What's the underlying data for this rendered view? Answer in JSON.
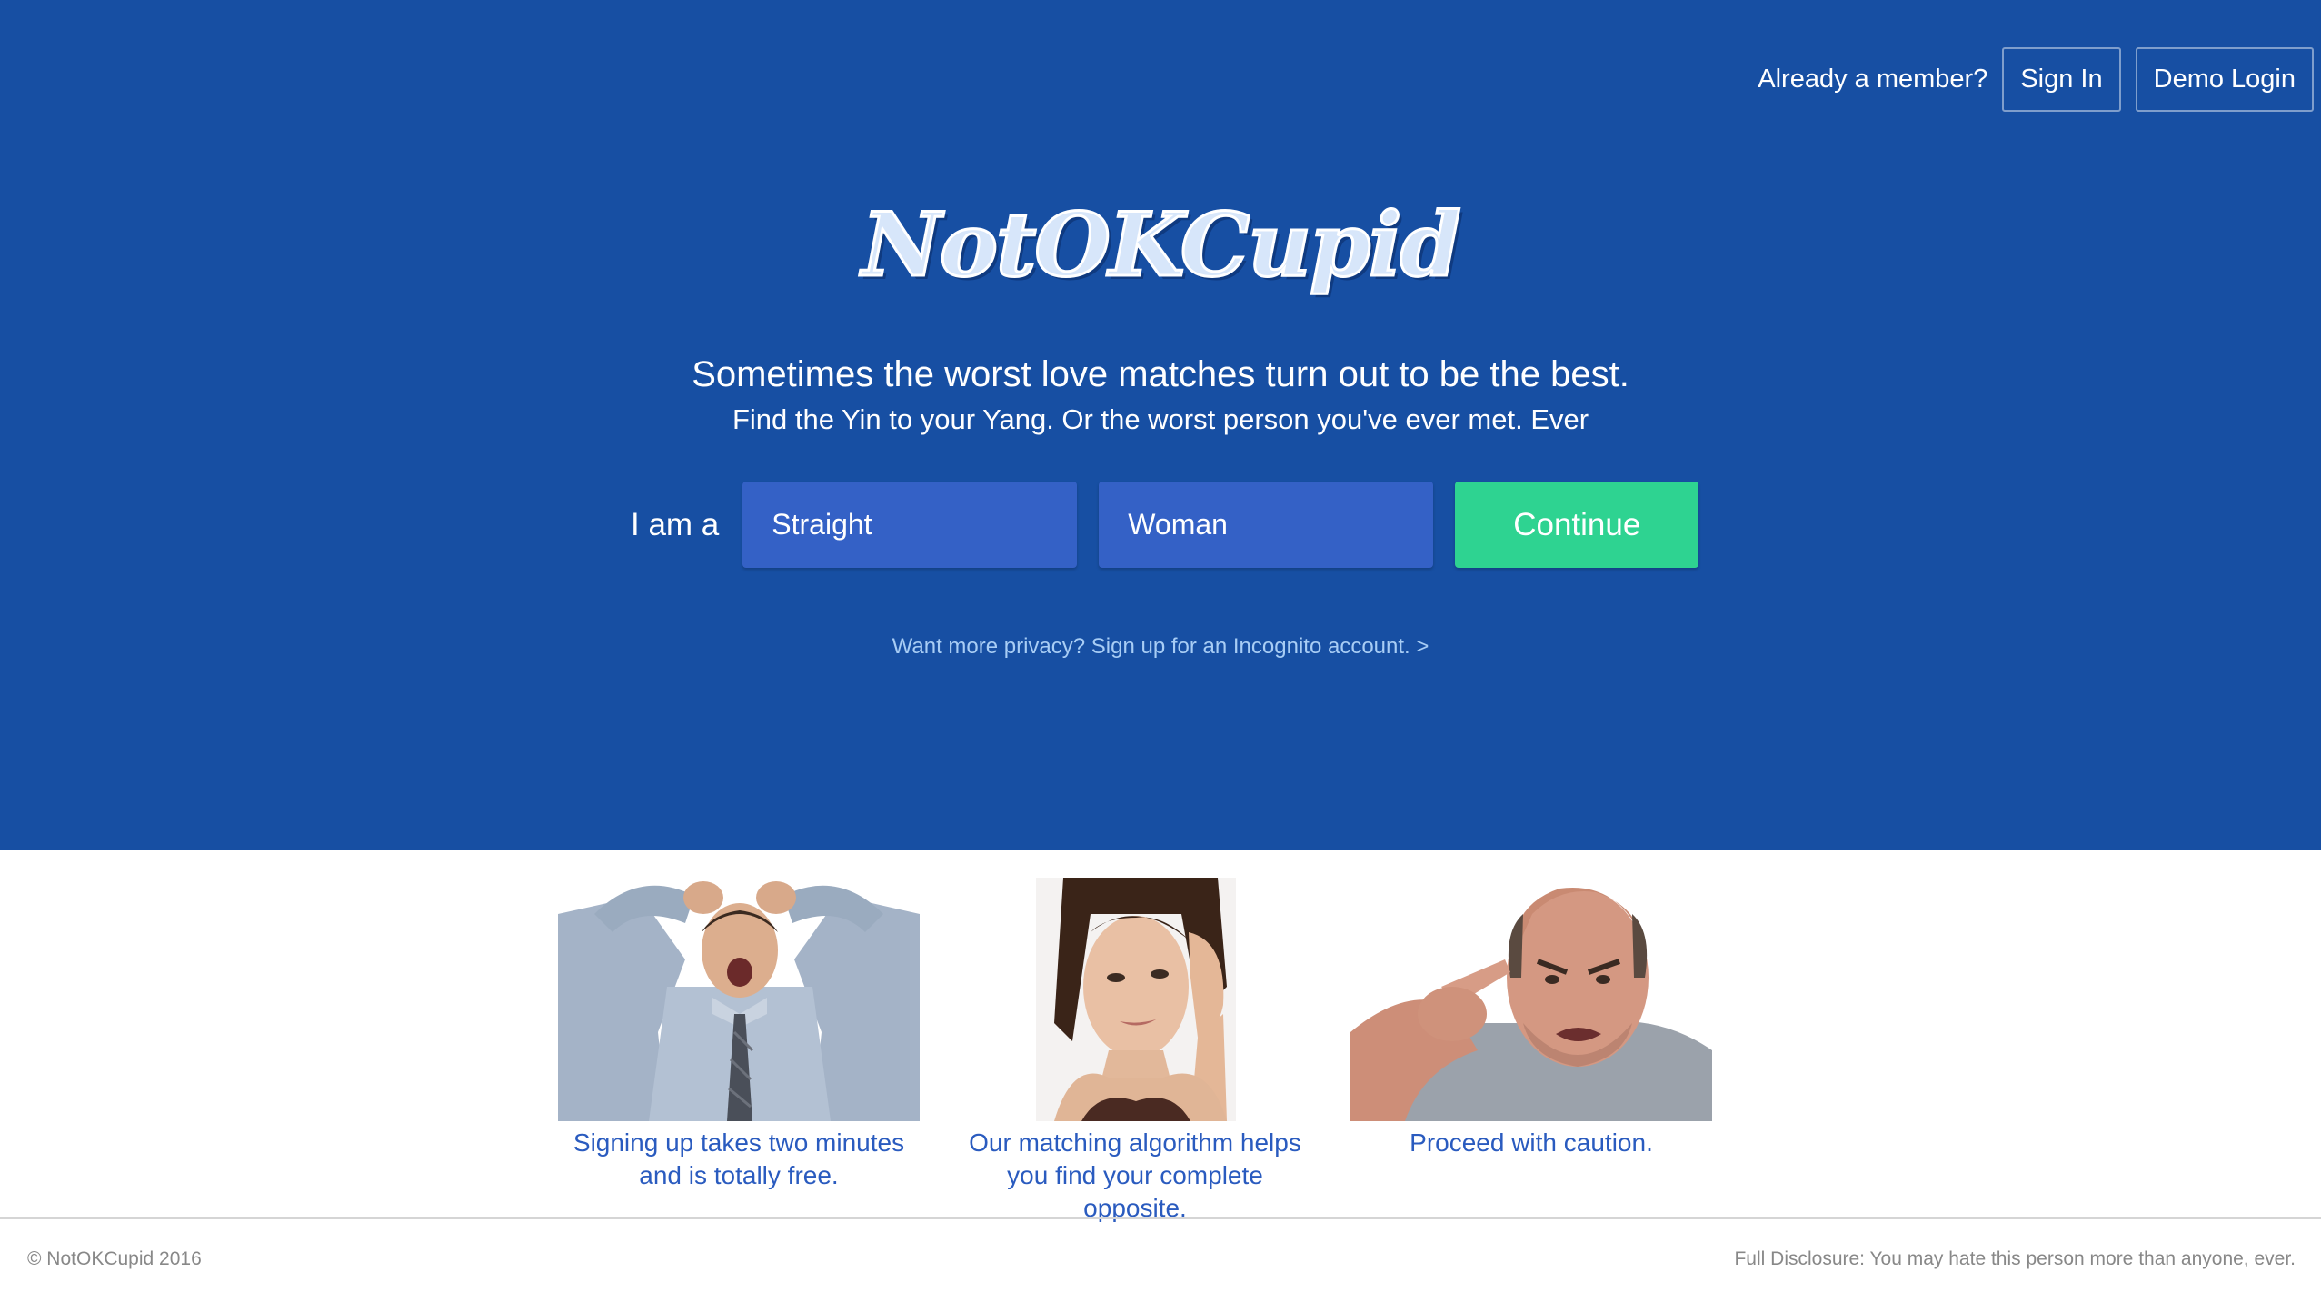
{
  "header": {
    "member_text": "Already a member?",
    "sign_in_label": "Sign In",
    "demo_login_label": "Demo Login"
  },
  "hero": {
    "logo_text": "NotOKCupid",
    "tagline": "Sometimes the worst love matches turn out to be the best.",
    "subtagline": "Find the Yin to your Yang. Or the worst person you've ever met. Ever",
    "iama_label": "I am a",
    "orientation_value": "Straight",
    "gender_value": "Woman",
    "continue_label": "Continue",
    "privacy_link": "Want more privacy? Sign up for an Incognito account. >"
  },
  "features": [
    {
      "image": "stressed-man-photo",
      "caption_line1": "Signing up takes two minutes",
      "caption_line2": "and is totally free."
    },
    {
      "image": "listening-woman-photo",
      "caption_line1": "Our matching algorithm helps",
      "caption_line2": "you find your complete opposite."
    },
    {
      "image": "angry-pointing-man-photo",
      "caption_line1": "Proceed with caution.",
      "caption_line2": ""
    }
  ],
  "footer": {
    "copyright": "© NotOKCupid 2016",
    "disclosure": "Full Disclosure: You may hate this person more than anyone, ever."
  },
  "colors": {
    "hero_background": "#174fa3",
    "select_background": "#3461c6",
    "continue_button": "#2ed391",
    "caption_text": "#2a5bbf",
    "privacy_link": "#a8cdf5"
  }
}
